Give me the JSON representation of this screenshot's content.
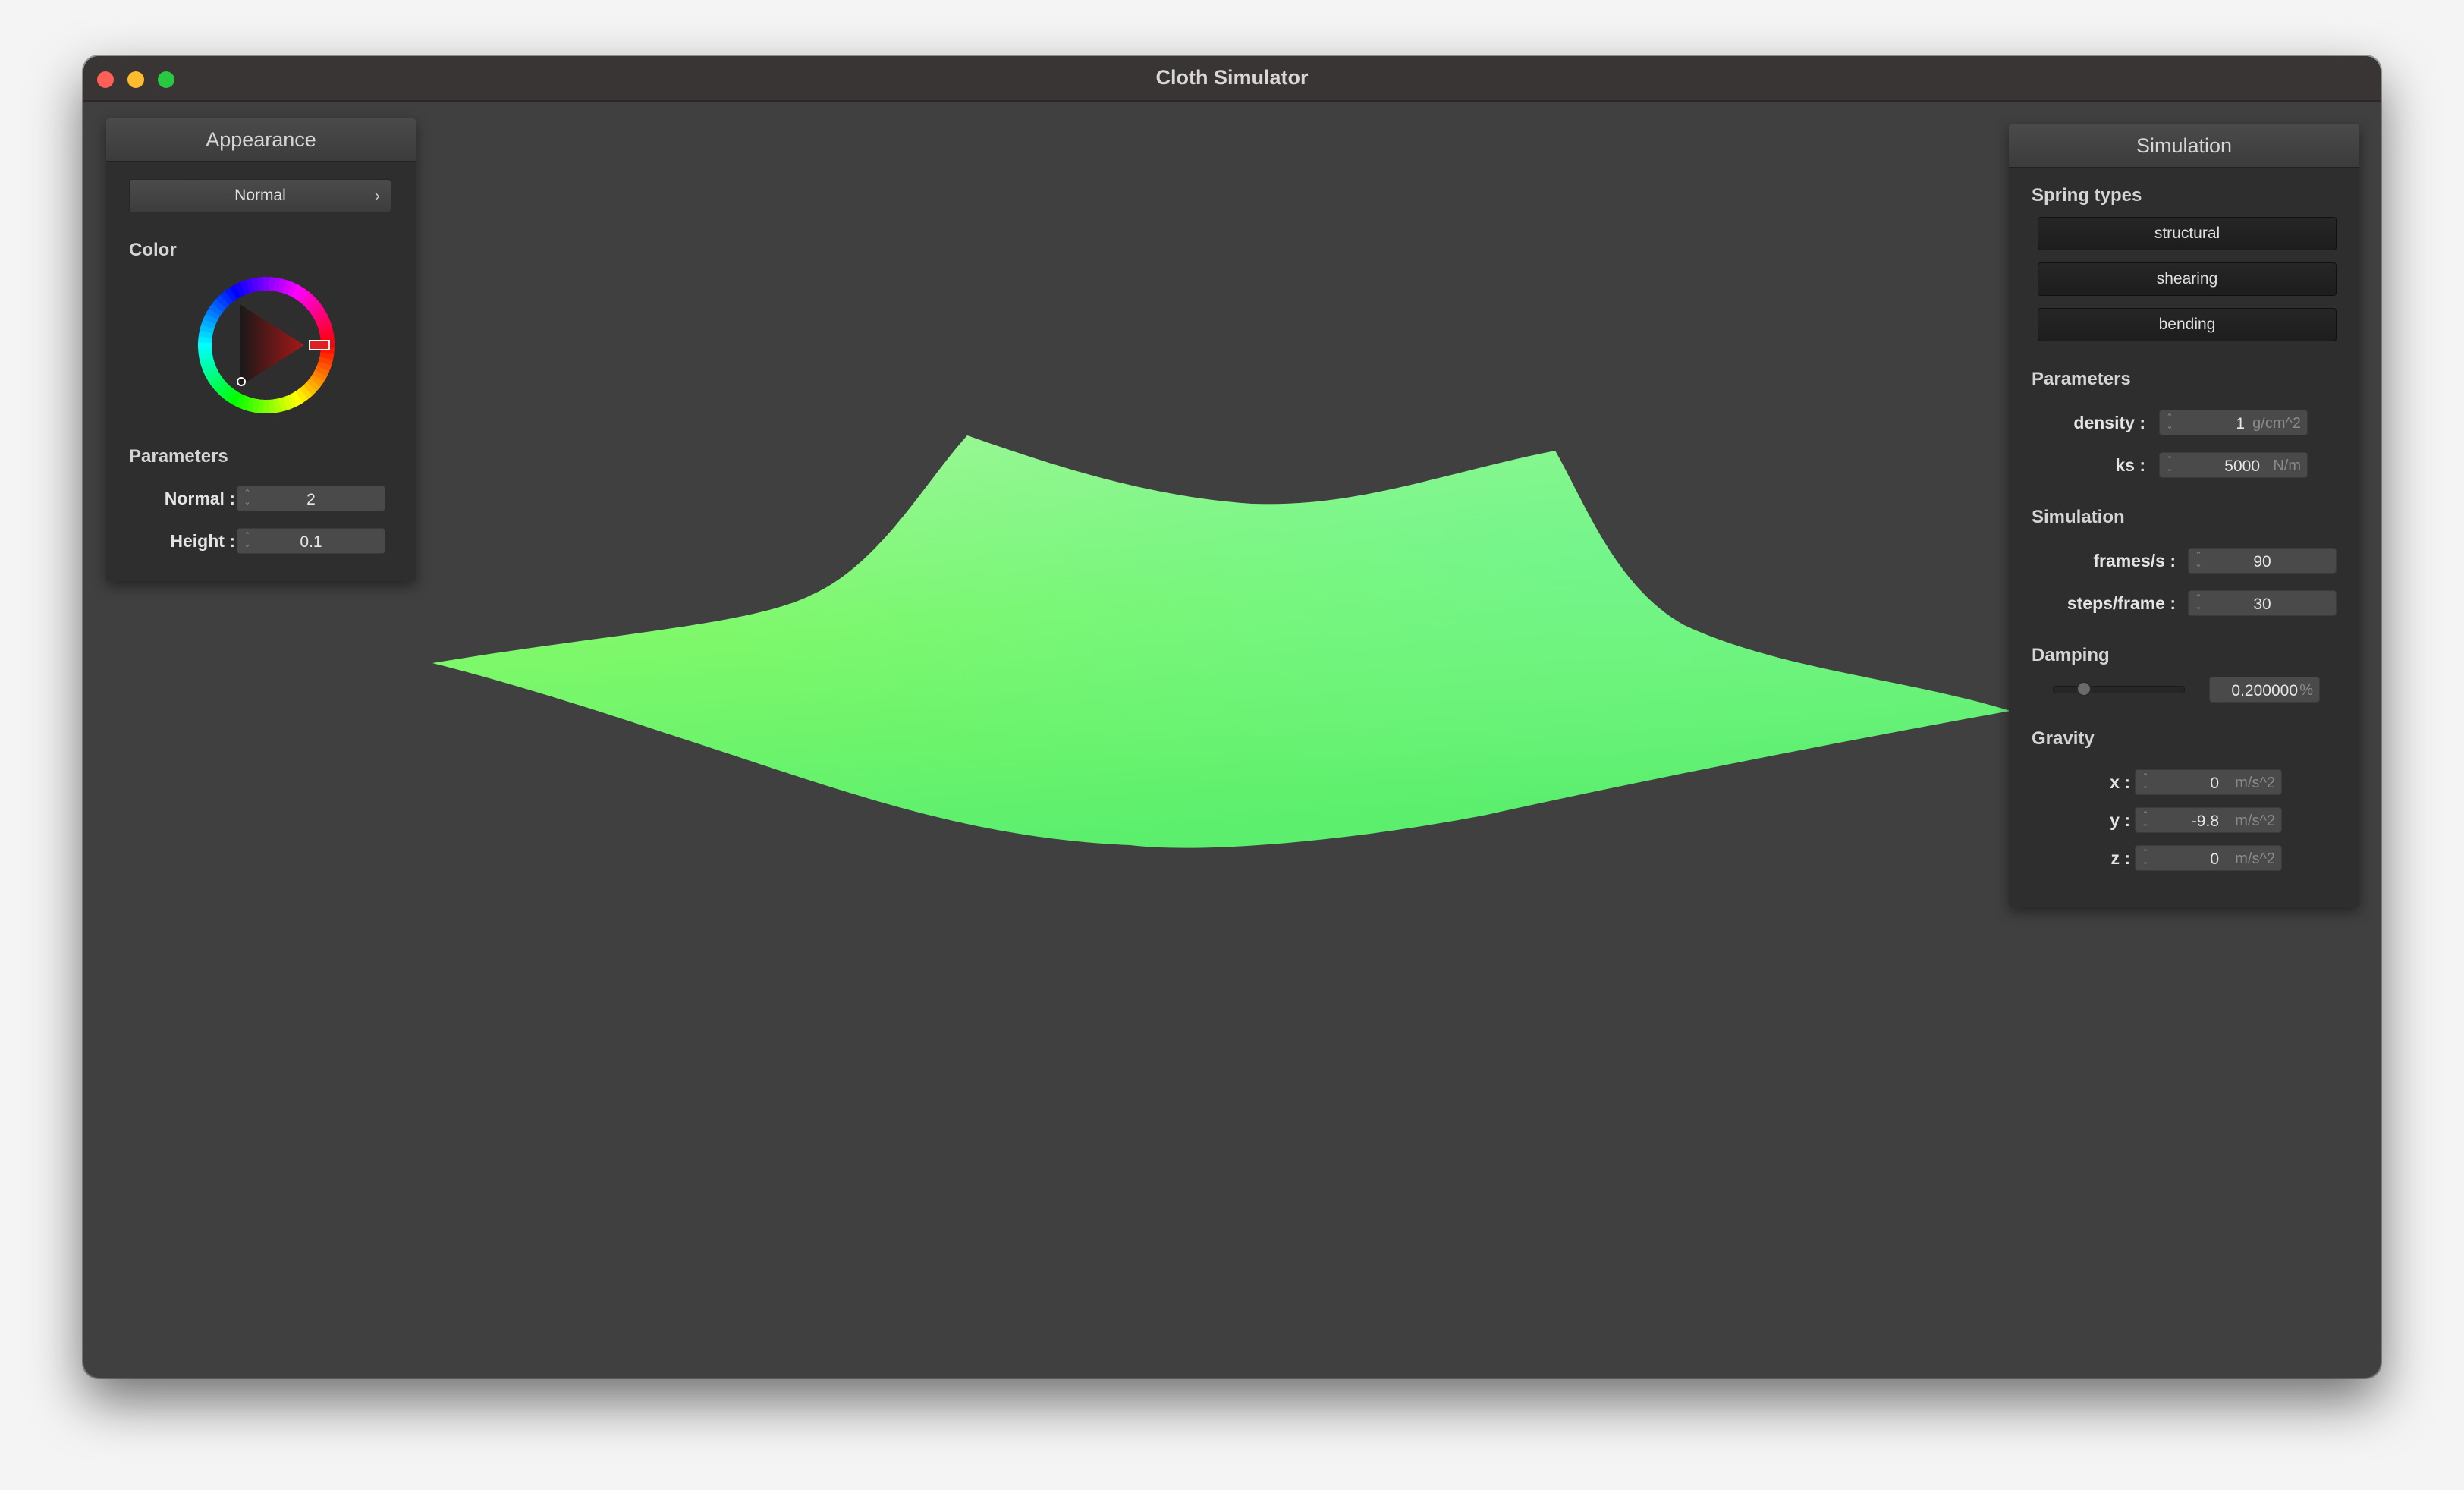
{
  "window": {
    "title": "Cloth Simulator"
  },
  "cloth": {
    "color_light": "#a2f79a",
    "color_mid": "#7ef86a",
    "color_dark": "#5cef6e",
    "accent_teal": "#6af2a6"
  },
  "appearance_panel": {
    "header": "Appearance",
    "shader_dropdown": {
      "selected": "Normal",
      "chevron_icon": "chevron-right-icon"
    },
    "color_label": "Color",
    "color_wheel": {
      "selected_color": "#e02020"
    },
    "parameters_label": "Parameters",
    "normal": {
      "label": "Normal :",
      "value": "2"
    },
    "height": {
      "label": "Height :",
      "value": "0.1"
    }
  },
  "simulation_panel": {
    "header": "Simulation",
    "spring_types_label": "Spring types",
    "spring_types": [
      "structural",
      "shearing",
      "bending"
    ],
    "parameters_label": "Parameters",
    "density": {
      "label": "density :",
      "value": "1",
      "unit": "g/cm^2"
    },
    "ks": {
      "label": "ks :",
      "value": "5000",
      "unit": "N/m"
    },
    "simulation_label": "Simulation",
    "frames_per_s": {
      "label": "frames/s :",
      "value": "90"
    },
    "steps_per_frame": {
      "label": "steps/frame :",
      "value": "30"
    },
    "damping_label": "Damping",
    "damping": {
      "value": "0.200000",
      "unit": "%",
      "slider_fraction": 0.2
    },
    "gravity_label": "Gravity",
    "gravity": [
      {
        "label": "x :",
        "value": "0",
        "unit": "m/s^2"
      },
      {
        "label": "y :",
        "value": "-9.8",
        "unit": "m/s^2"
      },
      {
        "label": "z :",
        "value": "0",
        "unit": "m/s^2"
      }
    ]
  }
}
